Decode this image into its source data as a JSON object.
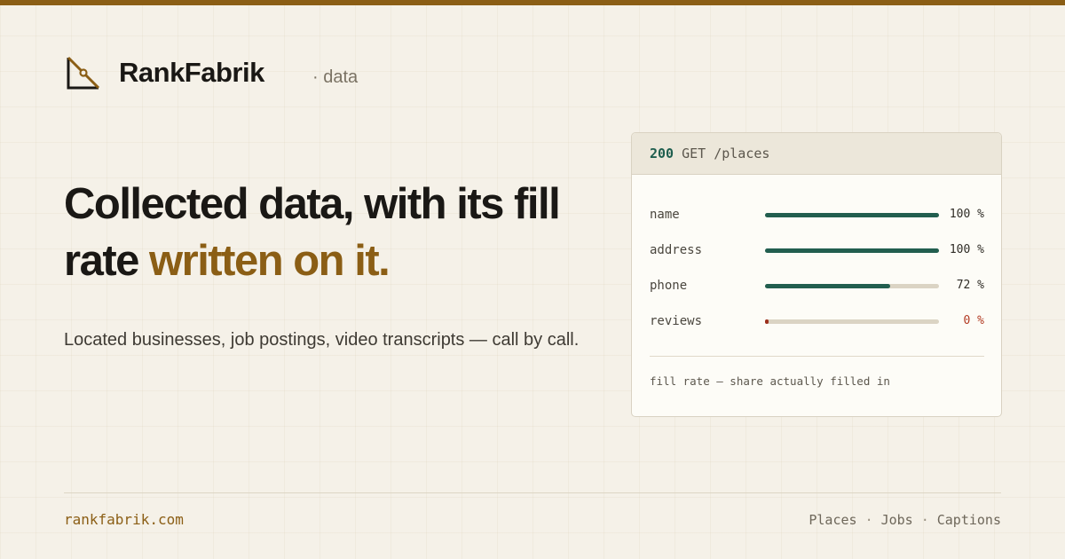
{
  "brand": {
    "name": "RankFabrik",
    "subtitle": "· data",
    "logo_icon": "set-square-icon",
    "accent_color": "#8b5e15"
  },
  "hero": {
    "headline_plain": "Collected data, with its fill rate",
    "headline_accent": "written on it.",
    "subline": "Located businesses, job postings, video transcripts — call by call."
  },
  "response_card": {
    "status": "200",
    "request": "GET /places",
    "fields": [
      {
        "name": "name",
        "fill": 1.0,
        "label": "100 %"
      },
      {
        "name": "address",
        "fill": 1.0,
        "label": "100 %"
      },
      {
        "name": "phone",
        "fill": 0.72,
        "label": "72 %"
      },
      {
        "name": "reviews",
        "fill": 0.0,
        "label": "0 %"
      }
    ],
    "note": "fill rate — share actually filled in",
    "colors": {
      "filled": "#225e4f",
      "empty": "#9c2f1c",
      "track": "#dbd4c4"
    }
  },
  "footer": {
    "domain": "rankfabrik.com",
    "links": [
      "Places",
      "Jobs",
      "Captions"
    ],
    "separator": "·"
  }
}
